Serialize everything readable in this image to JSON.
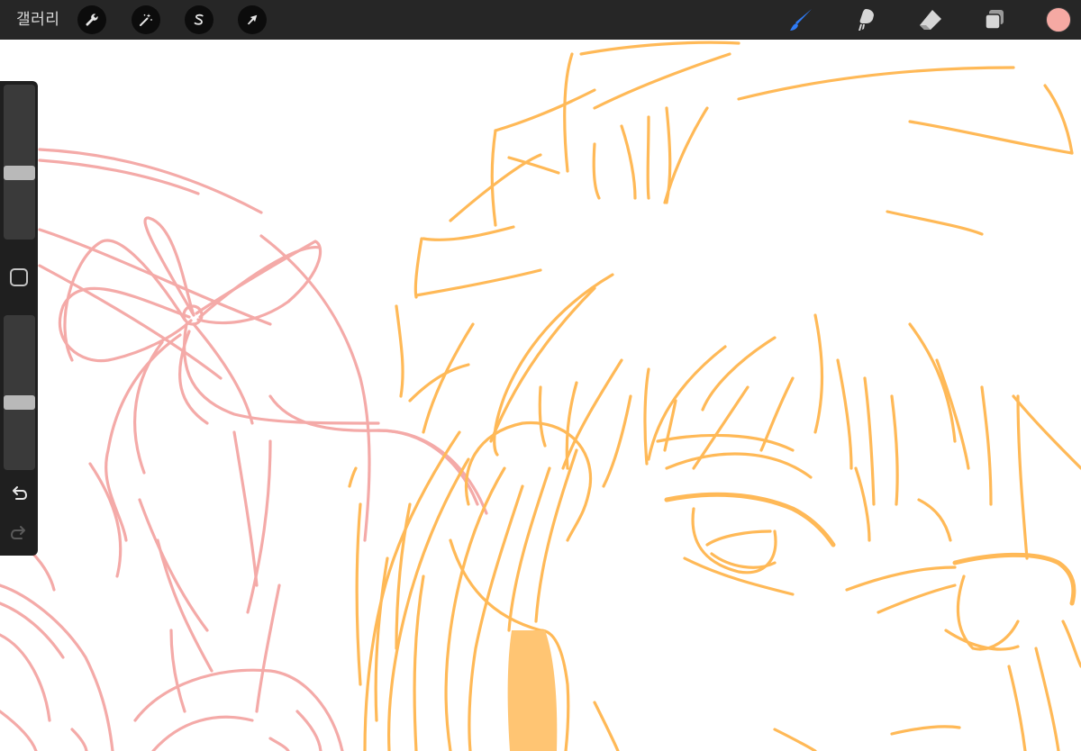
{
  "topbar": {
    "gallery_label": "갤러리",
    "left_tools": [
      {
        "name": "actions",
        "icon": "wrench-icon"
      },
      {
        "name": "adjustments",
        "icon": "magic-wand-icon"
      },
      {
        "name": "selection",
        "icon": "selection-s-icon"
      },
      {
        "name": "transform",
        "icon": "arrow-cursor-icon"
      }
    ],
    "right_tools": [
      {
        "name": "brush",
        "icon": "brush-icon",
        "active": true
      },
      {
        "name": "smudge",
        "icon": "smudge-icon"
      },
      {
        "name": "eraser",
        "icon": "eraser-icon"
      },
      {
        "name": "layers",
        "icon": "layers-icon"
      }
    ],
    "current_color": "#f5a9a3"
  },
  "sidebar": {
    "brush_size_level": 0.58,
    "opacity_level": 0.57,
    "modify_icon": "square-icon",
    "undo_icon": "undo-icon",
    "redo_icon": "redo-icon"
  },
  "colors": {
    "toolbar_bg": "#262626",
    "active_tool": "#2f7bf5",
    "sketch_pink": "#f4aaa8",
    "sketch_orange": "#ffb957",
    "fill_orange": "#ffc573"
  }
}
